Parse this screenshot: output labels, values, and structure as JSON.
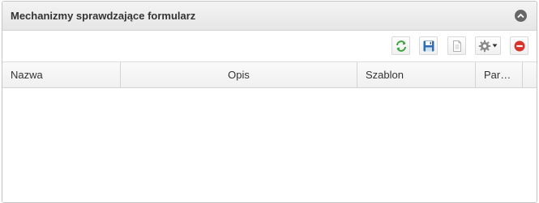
{
  "panel": {
    "title": "Mechanizmy sprawdzające formularz"
  },
  "toolbar": {
    "buttons": [
      {
        "icon": "refresh-icon",
        "tooltip": ""
      },
      {
        "icon": "save-icon",
        "tooltip": ""
      },
      {
        "icon": "document-icon",
        "tooltip": ""
      },
      {
        "icon": "gear-icon",
        "tooltip": ""
      },
      {
        "icon": "remove-icon",
        "tooltip": ""
      }
    ]
  },
  "grid": {
    "columns": [
      {
        "label": "Nazwa"
      },
      {
        "label": "Opis"
      },
      {
        "label": "Szablon"
      },
      {
        "label": "Par…"
      }
    ],
    "rows": []
  },
  "colors": {
    "header_bg": "#ececec",
    "border": "#c5c5c5",
    "refresh_green": "#3aa43a",
    "save_blue": "#2f6db5",
    "remove_red": "#d9342b"
  }
}
